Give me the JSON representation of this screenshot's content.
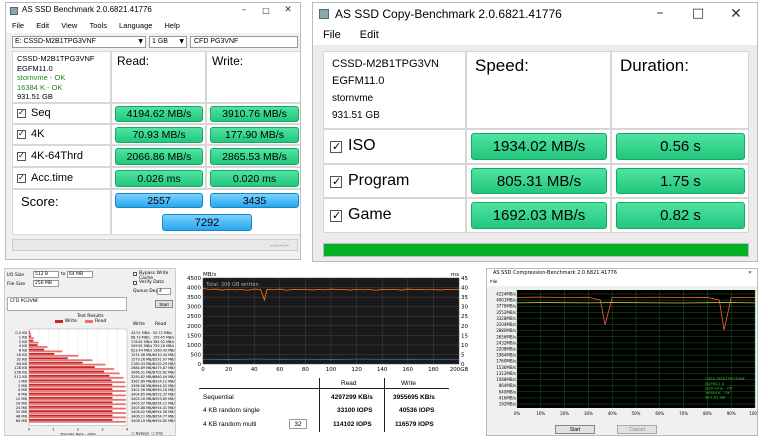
{
  "win1": {
    "title": "AS SSD Benchmark 2.0.6821.41776",
    "menu": [
      "File",
      "Edit",
      "View",
      "Tools",
      "Language",
      "Help"
    ],
    "drive_select": "E: CSSD-M2B1TPG3VNF",
    "size_select": "1 GB",
    "name_field": "CFD PG3VNF",
    "info": [
      "CSSD-M2B1TPG3VNF",
      "EGFM11.0",
      "stornvme - OK",
      "16384 K - OK",
      "931.51 GB"
    ],
    "read_header": "Read:",
    "write_header": "Write:",
    "rows": [
      {
        "label": "Seq",
        "read": "4194.62 MB/s",
        "write": "3910.76 MB/s"
      },
      {
        "label": "4K",
        "read": "70.93 MB/s",
        "write": "177.90 MB/s"
      },
      {
        "label": "4K-64Thrd",
        "read": "2066.86 MB/s",
        "write": "2865.53 MB/s"
      },
      {
        "label": "Acc.time",
        "read": "0.026 ms",
        "write": "0.020 ms"
      }
    ],
    "score_label": "Score:",
    "score_read": "2557",
    "score_write": "3435",
    "score_total": "7292",
    "status_right": "--:--:--"
  },
  "win2": {
    "title": "AS SSD Copy-Benchmark 2.0.6821.41776",
    "menu": [
      "File",
      "Edit"
    ],
    "info": [
      "CSSD-M2B1TPG3VN",
      "EGFM11.0",
      "stornvme",
      "931.51 GB"
    ],
    "speed_header": "Speed:",
    "duration_header": "Duration:",
    "rows": [
      {
        "label": "ISO",
        "speed": "1934.02 MB/s",
        "duration": "0.56 s"
      },
      {
        "label": "Program",
        "speed": "805.31 MB/s",
        "duration": "1.75 s"
      },
      {
        "label": "Game",
        "speed": "1692.03 MB/s",
        "duration": "0.82 s"
      }
    ],
    "progress": 1.0
  },
  "win3": {
    "io_size_label": "I/O Size",
    "io_size_from": "512 B",
    "io_size_to": "64 MB",
    "file_size_label": "File Size",
    "file_size": "256 MB",
    "bypass_write_cache": "Bypass Write Cache",
    "verify_data": "Verify Data",
    "queue_depth_label": "Queue Depth",
    "queue_depth": "4",
    "device_name": "CFD PG3VNF",
    "start_button": "Start",
    "test_results": "Test Results",
    "legend_write": "Write",
    "legend_read": "Read",
    "col_write": "Write",
    "col_read": "Read",
    "rows": [
      {
        "size": "0.5 KB",
        "write": 43.51,
        "read": 92.72
      },
      {
        "size": "1 KB",
        "write": 88.73,
        "read": 195.45
      },
      {
        "size": "2 KB",
        "write": 178.61,
        "read": 384.02
      },
      {
        "size": "4 KB",
        "write": 349.81,
        "read": 755.18
      },
      {
        "size": "8 KB",
        "write": 623.44,
        "read": 1360.43
      },
      {
        "size": "16 KB",
        "write": 1031.06,
        "read": 2010.44
      },
      {
        "size": "32 KB",
        "write": 1579.26,
        "read": 2591.07
      },
      {
        "size": "64 KB",
        "write": 2189.43,
        "read": 3120.29
      },
      {
        "size": "128 KB",
        "write": 2684.89,
        "read": 3475.87
      },
      {
        "size": "256 KB",
        "write": 3066.31,
        "read": 3702.62
      },
      {
        "size": "512 KB",
        "write": 3290.82,
        "read": 3860.04
      },
      {
        "size": "1 MB",
        "write": 3367.89,
        "read": 3924.12
      },
      {
        "size": "2 MB",
        "write": 3396.08,
        "read": 3944.02
      },
      {
        "size": "4 MB",
        "write": 3401.56,
        "read": 3950.18
      },
      {
        "size": "8 MB",
        "write": 3404.65,
        "read": 3952.37
      },
      {
        "size": "12 MB",
        "write": 3405.16,
        "read": 3953.69
      },
      {
        "size": "16 MB",
        "write": 3405.47,
        "read": 3954.12
      },
      {
        "size": "24 MB",
        "write": 3405.88,
        "read": 3954.41
      },
      {
        "size": "32 MB",
        "write": 3406.02,
        "read": 3954.58
      },
      {
        "size": "48 MB",
        "write": 3406.11,
        "read": 3954.77
      },
      {
        "size": "64 MB",
        "write": 3406.19,
        "read": 3954.85
      }
    ],
    "x_axis_label": "Transfer Rate - GB/s",
    "unit_options": [
      "Bytes/s",
      "IO/s"
    ]
  },
  "win4": {
    "chart_data": {
      "type": "line",
      "title": "",
      "xlabel": "",
      "ylabel": "MB/s",
      "ylim": [
        0,
        4500
      ],
      "xlim": [
        0,
        200
      ],
      "x_unit": "GB",
      "y_unit_right": "ms",
      "overlay_text": "Total: 200 GB written",
      "y_ticks": [
        0,
        500,
        1000,
        1500,
        2000,
        2500,
        3000,
        3500,
        4000,
        4500
      ],
      "x_ticks": [
        0,
        20,
        40,
        60,
        80,
        100,
        120,
        140,
        160,
        180,
        200
      ],
      "y_right_ticks": [
        0,
        5,
        10,
        15,
        20,
        25,
        30,
        35,
        40,
        45
      ],
      "series": [
        {
          "name": "Write speed",
          "color": "#ff7a1a",
          "x": [
            0,
            5,
            10,
            15,
            20,
            25,
            30,
            35,
            40,
            45,
            48,
            50,
            55,
            60,
            65,
            70,
            75,
            80,
            85,
            90,
            95,
            100,
            105,
            110,
            115,
            120,
            125,
            130,
            135,
            140,
            145,
            150,
            155,
            160,
            165,
            170,
            175,
            180,
            185,
            190,
            195,
            200
          ],
          "y": [
            3950,
            3900,
            3920,
            3870,
            3910,
            3880,
            3900,
            3860,
            3920,
            3890,
            3350,
            3900,
            3880,
            3920,
            3860,
            3900,
            3890,
            3910,
            3870,
            3900,
            3880,
            3920,
            3890,
            3900,
            3870,
            3910,
            3880,
            3900,
            3860,
            3910,
            3890,
            3900,
            3870,
            3920,
            3890,
            3900,
            3880,
            3910,
            3870,
            3900,
            3890,
            3900
          ]
        },
        {
          "name": "Access time",
          "color": "#3b6fd1",
          "x": [
            0,
            20,
            40,
            60,
            80,
            100,
            120,
            140,
            160,
            180,
            200
          ],
          "y": [
            250,
            240,
            255,
            245,
            250,
            240,
            255,
            250,
            245,
            250,
            248
          ]
        }
      ]
    },
    "result_header_read": "Read",
    "result_header_write": "Write",
    "results": [
      {
        "label": "Sequential",
        "read": "4297299 KB/s",
        "write": "3955695 KB/s"
      },
      {
        "label": "4 KB random single",
        "read": "33100 IOPS",
        "write": "40536 IOPS"
      },
      {
        "label": "4 KB random multi",
        "qd": "32",
        "read": "114102 IOPS",
        "write": "116579 IOPS"
      }
    ]
  },
  "win5": {
    "title": "AS SSD Compression-Benchmark 2.0.6821.41776",
    "menu": [
      "File"
    ],
    "chart_data": {
      "type": "line",
      "title": "",
      "xlabel": "",
      "ylabel": "",
      "ylim": [
        0,
        4224
      ],
      "y_ticks_labels": [
        "4224MB/s",
        "4001MB/s",
        "3776MB/s",
        "3552MB/s",
        "3328MB/s",
        "3104MB/s",
        "2880MB/s",
        "2656MB/s",
        "2432MB/s",
        "2208MB/s",
        "1984MB/s",
        "1760MB/s",
        "1536MB/s",
        "1312MB/s",
        "1088MB/s",
        "864MB/s",
        "640MB/s",
        "416MB/s",
        "192MB/s"
      ],
      "x_ticks_labels": [
        "0%",
        "10%",
        "20%",
        "30%",
        "40%",
        "50%",
        "60%",
        "70%",
        "80%",
        "90%",
        "100%"
      ],
      "series": [
        {
          "name": "Read",
          "color": "#ff5a4a",
          "x": [
            0,
            10,
            20,
            30,
            35,
            37,
            40,
            50,
            60,
            70,
            80,
            85,
            87,
            90,
            100
          ],
          "y": [
            4100,
            4110,
            4095,
            4105,
            4000,
            3100,
            4090,
            4100,
            4105,
            4095,
            4100,
            4000,
            2900,
            4100,
            4100
          ]
        },
        {
          "name": "Write",
          "color": "#d2c24a",
          "x": [
            0,
            10,
            20,
            30,
            40,
            50,
            60,
            70,
            80,
            90,
            100
          ],
          "y": [
            3900,
            3910,
            3905,
            3900,
            3910,
            3905,
            3900,
            3895,
            3905,
            3910,
            3900
          ]
        }
      ]
    },
    "legend_title": "CSSD-M2B1TPG3VNF",
    "legend_lines": [
      "EGFM11.0",
      "stornvme - OK",
      "16384 K - OK",
      "931.51 GB"
    ],
    "start_button": "Start",
    "cancel_button": "Cancel"
  }
}
